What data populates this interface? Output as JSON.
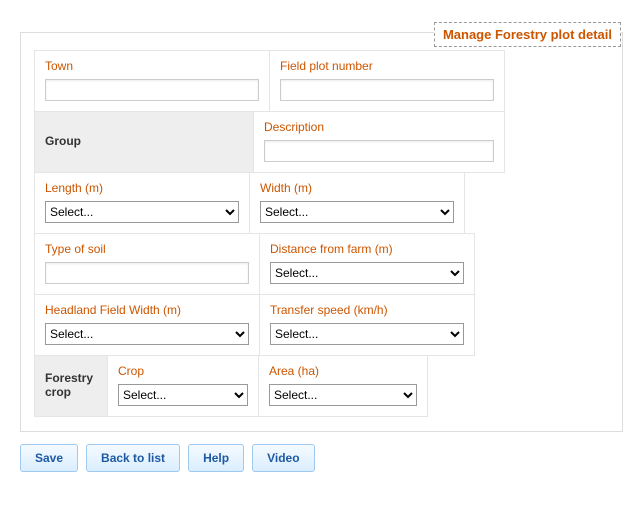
{
  "title": "Manage Forestry plot detail",
  "fields": {
    "town": {
      "label": "Town",
      "value": ""
    },
    "field_plot_number": {
      "label": "Field plot number",
      "value": ""
    },
    "group": {
      "label": "Group"
    },
    "description": {
      "label": "Description",
      "value": ""
    },
    "length": {
      "label": "Length (m)",
      "value": "Select..."
    },
    "width": {
      "label": "Width (m)",
      "value": "Select..."
    },
    "type_of_soil": {
      "label": "Type of soil",
      "value": ""
    },
    "distance_from_farm": {
      "label": "Distance from farm (m)",
      "value": "Select..."
    },
    "headland_width": {
      "label": "Headland Field Width (m)",
      "value": "Select..."
    },
    "transfer_speed": {
      "label": "Transfer speed (km/h)",
      "value": "Select..."
    },
    "forestry_crop": {
      "label": "Forestry crop"
    },
    "crop": {
      "label": "Crop",
      "value": "Select..."
    },
    "area": {
      "label": "Area (ha)",
      "value": "Select..."
    }
  },
  "select_placeholder": "Select...",
  "buttons": {
    "save": "Save",
    "back": "Back to list",
    "help": "Help",
    "video": "Video"
  }
}
